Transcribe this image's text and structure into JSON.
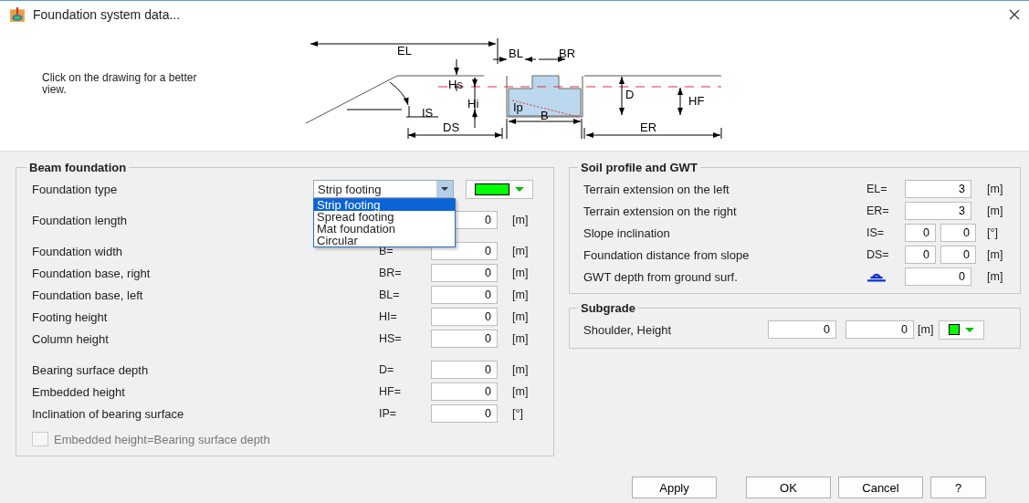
{
  "window": {
    "title": "Foundation system data..."
  },
  "hint": "Click on the drawing for a better view.",
  "diagram": {
    "labels": [
      "EL",
      "BL",
      "BR",
      "Hs",
      "Hi",
      "IS",
      "DS",
      "Ip",
      "B",
      "D",
      "HF",
      "ER"
    ]
  },
  "beam_foundation": {
    "title": "Beam foundation",
    "sections": [
      [
        {
          "kind": "select",
          "label": "Foundation type",
          "value": "Strip footing",
          "expanded": true,
          "options": [
            {
              "label": "Strip footing",
              "selected": true
            },
            {
              "label": "Spread footing",
              "selected": false
            },
            {
              "label": "Mat foundation",
              "selected": false
            },
            {
              "label": "Circular",
              "selected": false
            }
          ],
          "color": "#00ff00"
        }
      ],
      [
        {
          "kind": "field",
          "label": "Foundation length",
          "value": "0",
          "unit": "[m]"
        }
      ],
      [
        {
          "kind": "field",
          "label": "Foundation width",
          "symbol": "B=",
          "value": "0",
          "unit": "[m]"
        },
        {
          "kind": "field",
          "label": "Foundation base, right",
          "symbol": "BR=",
          "value": "0",
          "unit": "[m]"
        },
        {
          "kind": "field",
          "label": "Foundation base, left",
          "symbol": "BL=",
          "value": "0",
          "unit": "[m]"
        },
        {
          "kind": "field",
          "label": "Footing height",
          "symbol": "HI=",
          "value": "0",
          "unit": "[m]"
        },
        {
          "kind": "field",
          "label": "Column height",
          "symbol": "HS=",
          "value": "0",
          "unit": "[m]"
        }
      ],
      [
        {
          "kind": "field",
          "label": "Bearing surface depth",
          "symbol": "D=",
          "value": "0",
          "unit": "[m]"
        },
        {
          "kind": "field",
          "label": "Embedded height",
          "symbol": "HF=",
          "value": "0",
          "unit": "[m]"
        },
        {
          "kind": "field",
          "label": "Inclination of bearing surface",
          "symbol": "IP=",
          "value": "0",
          "unit": "[°]"
        }
      ]
    ],
    "checkbox": {
      "label": "Embedded height=Bearing surface depth",
      "checked": false,
      "disabled": true
    }
  },
  "soil_profile": {
    "title": "Soil profile and GWT",
    "rows": [
      {
        "kind": "single",
        "label": "Terrain extension on the left",
        "symbol": "EL=",
        "values": [
          "3"
        ],
        "unit": "[m]"
      },
      {
        "kind": "single",
        "label": "Terrain extension on the right",
        "symbol": "ER=",
        "values": [
          "3"
        ],
        "unit": "[m]"
      },
      {
        "kind": "double",
        "label": "Slope inclination",
        "symbol": "IS=",
        "values": [
          "0",
          "0"
        ],
        "unit": "[°]"
      },
      {
        "kind": "double",
        "label": "Foundation distance from slope",
        "symbol": "DS=",
        "values": [
          "0",
          "0"
        ],
        "unit": "[m]"
      },
      {
        "kind": "gwt",
        "label": "GWT depth from ground surf.",
        "values": [
          "0"
        ],
        "unit": "[m]"
      }
    ]
  },
  "subgrade": {
    "title": "Subgrade",
    "label": "Shoulder, Height",
    "values": [
      "0",
      "0"
    ],
    "unit": "[m]",
    "color": "#00ff00"
  },
  "buttons": [
    "Apply",
    "OK",
    "Cancel",
    "?"
  ]
}
